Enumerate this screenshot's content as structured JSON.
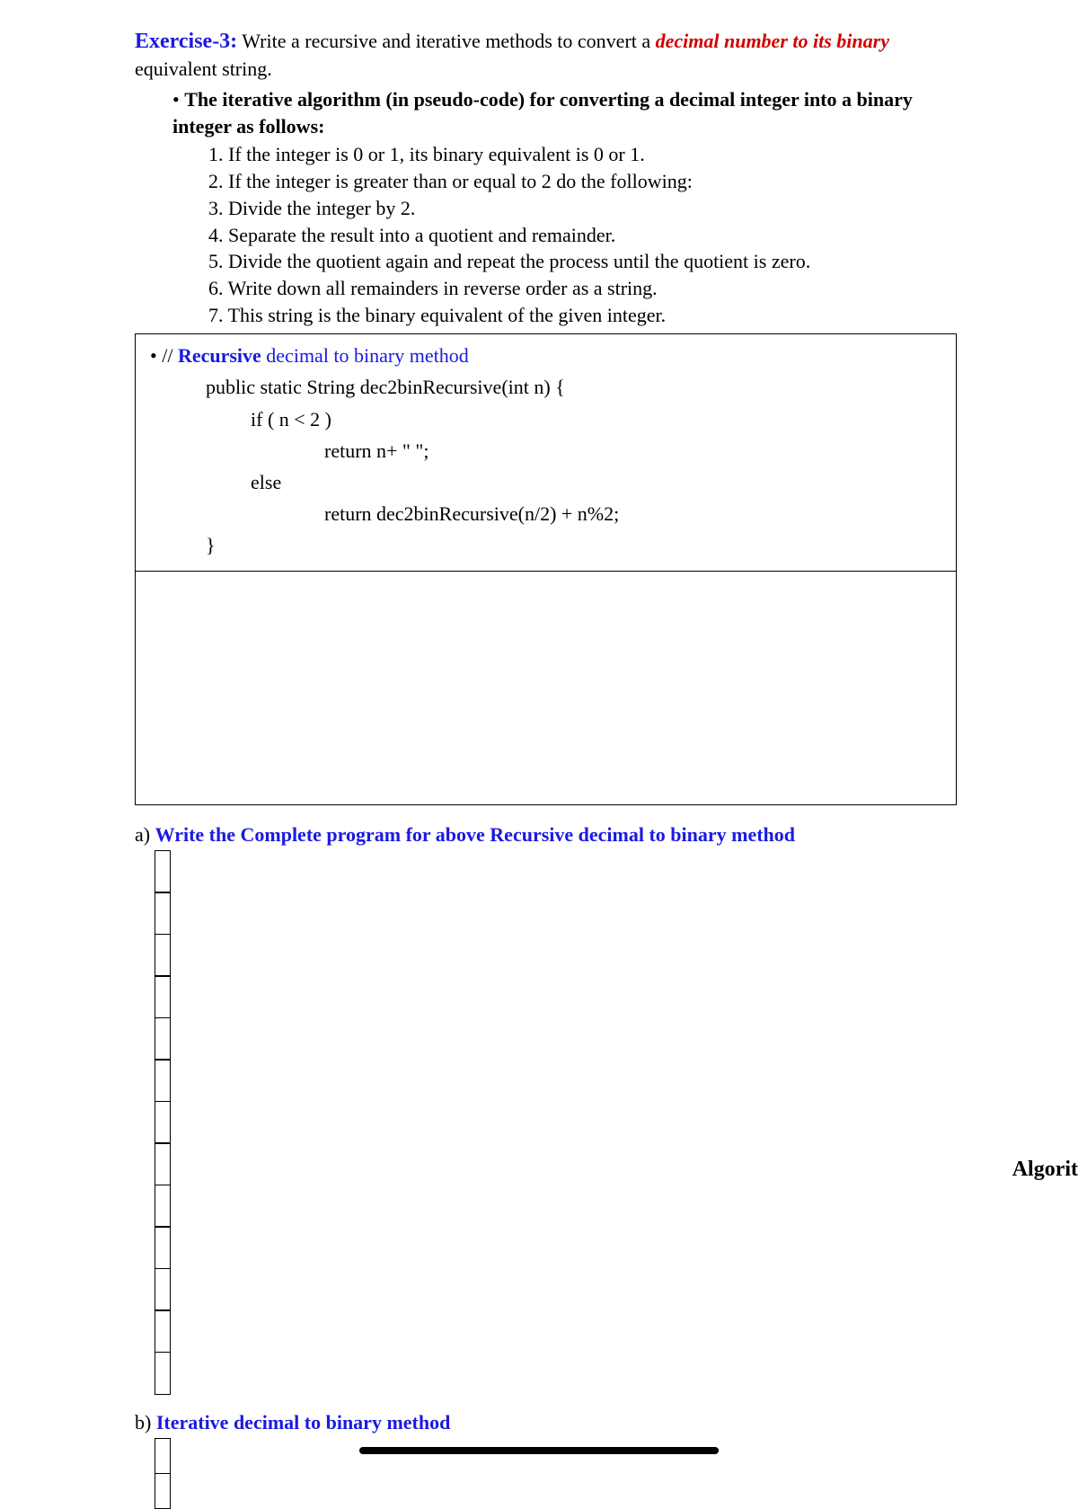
{
  "exercise": {
    "titleLabel": "Exercise-3:",
    "introPlain1": "  Write a recursive and iterative methods to convert a ",
    "introRed": "decimal number to its binary",
    "introPlain2": " equivalent string."
  },
  "bullet1": {
    "dot": "• ",
    "boldText": "The iterative algorithm (in pseudo-code) for converting a decimal integer into a binary integer as follows:"
  },
  "steps": {
    "s1": "1. If the integer is 0 or 1, its binary equivalent is 0 or 1.",
    "s2": "2. If the integer is greater than or equal to 2 do the following:",
    "s3": "3. Divide the integer by 2.",
    "s4": "4. Separate the result into a quotient and remainder.",
    "s5": "5. Divide the quotient again and repeat the process until the quotient is zero.",
    "s6": "6. Write down all remainders in reverse order as a string.",
    "s7": "7. This string is the binary equivalent of the given integer."
  },
  "code": {
    "comment_prefix": "• // ",
    "comment_blue": "Recursive",
    "comment_rest": " decimal to binary method",
    "line1": "public static String dec2binRecursive(int n) {",
    "line2": "if ( n < 2 )",
    "line3": "return n+ \" \";",
    "line4": "else",
    "line5": "return dec2binRecursive(n/2) + n%2;",
    "line6": "}"
  },
  "sectionA": {
    "letter": "a) ",
    "blueText": "Write the Complete program for above Recursive decimal to binary method"
  },
  "sectionB": {
    "letter": "b) ",
    "blueText": "Iterative decimal to binary method"
  },
  "right": {
    "fragment": "Algorit"
  }
}
